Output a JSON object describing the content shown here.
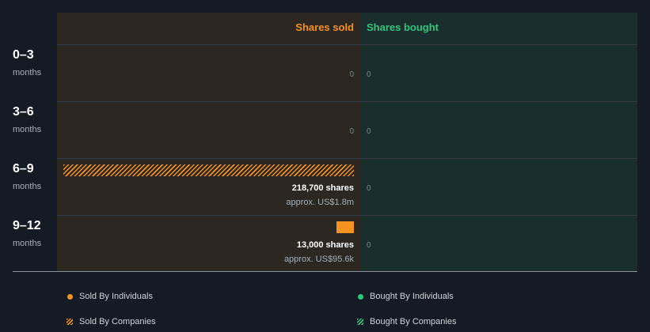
{
  "chart_data": {
    "type": "bar",
    "orientation": "horizontal",
    "columns": [
      "Shares sold",
      "Shares bought"
    ],
    "categories": [
      {
        "range": "0–3",
        "unit": "months"
      },
      {
        "range": "3–6",
        "unit": "months"
      },
      {
        "range": "6–9",
        "unit": "months"
      },
      {
        "range": "9–12",
        "unit": "months"
      }
    ],
    "sold": [
      {
        "total_label": "0",
        "by_companies": 0,
        "by_individuals": 0,
        "shares_label": "",
        "approx_label": ""
      },
      {
        "total_label": "0",
        "by_companies": 0,
        "by_individuals": 0,
        "shares_label": "",
        "approx_label": ""
      },
      {
        "total_label": "",
        "by_companies": 218700,
        "by_individuals": 0,
        "shares_label": "218,700 shares",
        "approx_label": "approx. US$1.8m"
      },
      {
        "total_label": "",
        "by_companies": 0,
        "by_individuals": 13000,
        "shares_label": "13,000 shares",
        "approx_label": "approx. US$95.6k"
      }
    ],
    "bought": [
      {
        "total_label": "0",
        "value": 0
      },
      {
        "total_label": "0",
        "value": 0
      },
      {
        "total_label": "0",
        "value": 0
      },
      {
        "total_label": "0",
        "value": 0
      }
    ],
    "max_value": 218700,
    "legend": [
      {
        "label": "Sold By Individuals",
        "style": "dot",
        "color": "#f6921e"
      },
      {
        "label": "Bought By Individuals",
        "style": "dot",
        "color": "#2fc57a"
      },
      {
        "label": "Sold By Companies",
        "style": "hatch",
        "color": "#f6921e"
      },
      {
        "label": "Bought By Companies",
        "style": "hatch",
        "color": "#2fc57a"
      }
    ],
    "colors": {
      "sold": "#f6921e",
      "bought": "#2fc57a"
    },
    "legend_placement": "bottom"
  }
}
